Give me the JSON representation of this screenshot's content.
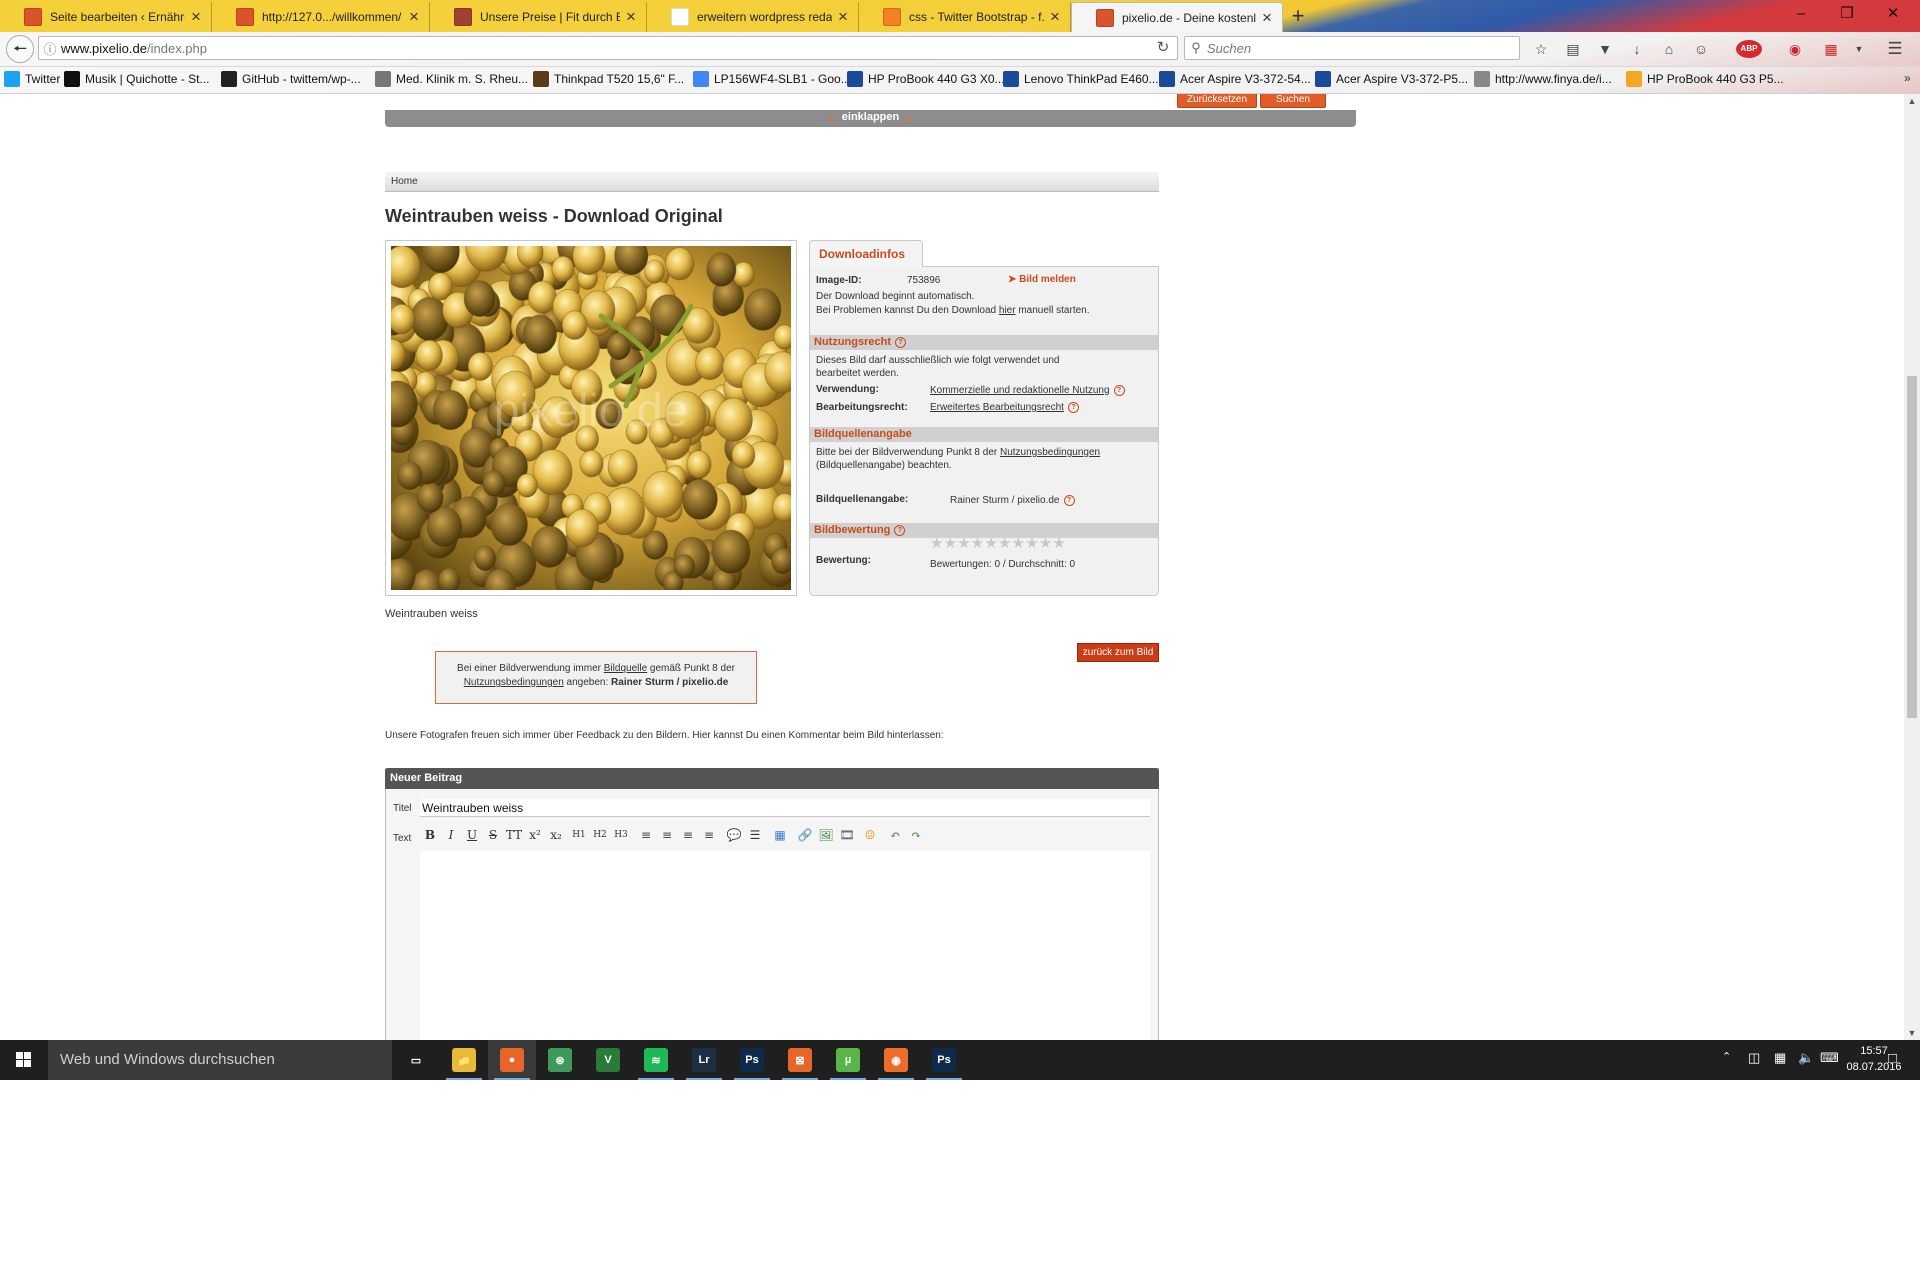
{
  "browser": {
    "tabs": [
      {
        "label": "Seite bearbeiten ‹ Ernähru...",
        "icon": "wp-admin-icon",
        "color": "#d9532b"
      },
      {
        "label": "http://127.0.../willkommen/",
        "icon": "xampp-icon",
        "color": "#d9532b"
      },
      {
        "label": "Unsere Preise | Fit durch E...",
        "icon": "site-icon",
        "color": "#a04030"
      },
      {
        "label": "erweitern wordpress redak...",
        "icon": "google-icon",
        "color": "#ffffff"
      },
      {
        "label": "css - Twitter Bootstrap - f...",
        "icon": "stackoverflow-icon",
        "color": "#f48024"
      },
      {
        "label": "pixelio.de - Deine kostenlo...",
        "icon": "pixelio-icon",
        "color": "#d9532b"
      }
    ],
    "active_tab": 5,
    "url_host": "www.pixelio.de",
    "url_path": "/index.php",
    "search_placeholder": "Suchen",
    "bookmarks": [
      {
        "label": "Twitter",
        "icon": "twitter-icon",
        "color": "#1da1f2"
      },
      {
        "label": "Musik | Quichotte - St...",
        "icon": "q-icon",
        "color": "#111111"
      },
      {
        "label": "GitHub - twittem/wp-...",
        "icon": "github-icon",
        "color": "#222222"
      },
      {
        "label": "Med. Klinik m. S. Rheu...",
        "icon": "clinic-icon",
        "color": "#777777"
      },
      {
        "label": "Thinkpad T520 15,6\" F...",
        "icon": "shop-icon",
        "color": "#5a3a1a"
      },
      {
        "label": "LP156WF4-SLB1 - Goo...",
        "icon": "google-icon",
        "color": "#4285f4"
      },
      {
        "label": "HP ProBook 440 G3 X0...",
        "icon": "cp-icon",
        "color": "#1a4a9a"
      },
      {
        "label": "Lenovo ThinkPad E460...",
        "icon": "cp-icon",
        "color": "#1a4a9a"
      },
      {
        "label": "Acer Aspire V3-372-54...",
        "icon": "cp-icon",
        "color": "#1a4a9a"
      },
      {
        "label": "Acer Aspire V3-372-P5...",
        "icon": "cp-icon",
        "color": "#1a4a9a"
      },
      {
        "label": "http://www.finya.de/i...",
        "icon": "finya-icon",
        "color": "#888888"
      },
      {
        "label": "HP ProBook 440 G3 P5...",
        "icon": "deal-icon",
        "color": "#f5a623"
      }
    ]
  },
  "page": {
    "collapse_buttons": {
      "reset": "Zurücksetzen",
      "search": "Suchen"
    },
    "collapse_label": "einklappen",
    "breadcrumb": "Home",
    "title": "Weintrauben weiss - Download Original",
    "caption": "Weintrauben weiss",
    "watermark": "pixelio.de",
    "info": {
      "tab_label": "Downloadinfos",
      "image_id_label": "Image-ID:",
      "image_id": "753896",
      "report_label": "Bild melden",
      "download_line1": "Der Download beginnt automatisch.",
      "download_line2_pre": "Bei Problemen kannst Du den Download ",
      "download_link": "hier",
      "download_line2_post": " manuell starten.",
      "usage_head": "Nutzungsrecht",
      "usage_text1": "Dieses Bild darf ausschließlich wie folgt verwendet und",
      "usage_text2": "bearbeitet werden.",
      "verwendung_label": "Verwendung:",
      "verwendung_value": "Kommerzielle und redaktionelle Nutzung",
      "bearbeitung_label": "Bearbeitungsrecht:",
      "bearbeitung_value": "Erweitertes Bearbeitungsrecht",
      "source_head": "Bildquellenangabe",
      "source_text1_pre": "Bitte bei der Bildverwendung Punkt 8 der ",
      "source_text1_link": "Nutzungsbedingungen",
      "source_text2": "(Bildquellenangabe) beachten.",
      "source_label": "Bildquellenangabe:",
      "source_value": "Rainer Sturm  / pixelio.de",
      "rating_head": "Bildbewertung",
      "rating_label": "Bewertung:",
      "rating_stars_total": 10,
      "rating_summary": "Bewertungen: 0 / Durchschnitt: 0"
    },
    "note": {
      "line1_pre": "Bei einer Bildverwendung immer ",
      "line1_link": "Bildquelle",
      "line1_post": " gemäß Punkt 8 der",
      "line2_link": "Nutzungsbedingungen",
      "line2_mid": " angeben: ",
      "line2_bold": "Rainer Sturm  / pixelio.de"
    },
    "back_button": "zurück zum Bild",
    "feedback_text": "Unsere Fotografen freuen sich immer über Feedback zu den Bildern. Hier kannst Du einen Kommentar beim Bild hinterlassen:",
    "editor": {
      "header": "Neuer Beitrag",
      "title_label": "Titel",
      "title_value": "Weintrauben weiss",
      "text_label": "Text",
      "toolbar": [
        "B",
        "I",
        "U",
        "S",
        "TT",
        "x²",
        "x₂",
        "H1",
        "H2",
        "H3",
        "≡",
        "≡",
        "≡",
        "≡",
        "💬",
        "☰",
        "▦",
        "🔗",
        "🖼",
        "🎞",
        "☺",
        "↶",
        "↷"
      ]
    }
  },
  "taskbar": {
    "search_placeholder": "Web und Windows durchsuchen",
    "time": "15:57",
    "date": "08.07.2016",
    "apps": [
      {
        "name": "task-view-icon",
        "label": "▭",
        "color": "#1f1f1f"
      },
      {
        "name": "explorer-icon",
        "label": "📁",
        "color": "#e9b93a"
      },
      {
        "name": "firefox-icon",
        "label": "●",
        "color": "#e8652a"
      },
      {
        "name": "sourcetree-icon",
        "label": "⊛",
        "color": "#3c9a5a"
      },
      {
        "name": "vivaldi-icon",
        "label": "V",
        "color": "#2a7a3a"
      },
      {
        "name": "spotify-icon",
        "label": "≋",
        "color": "#1db954"
      },
      {
        "name": "lightroom-icon",
        "label": "Lr",
        "color": "#1e2f45"
      },
      {
        "name": "photoshop-icon",
        "label": "Ps",
        "color": "#0f2a4a"
      },
      {
        "name": "xampp-icon",
        "label": "⊠",
        "color": "#e8652a"
      },
      {
        "name": "utorrent-icon",
        "label": "µ",
        "color": "#5ab548"
      },
      {
        "name": "origin-icon",
        "label": "◉",
        "color": "#f06a2a"
      },
      {
        "name": "photoshop-icon",
        "label": "Ps",
        "color": "#0f2a4a"
      }
    ]
  }
}
